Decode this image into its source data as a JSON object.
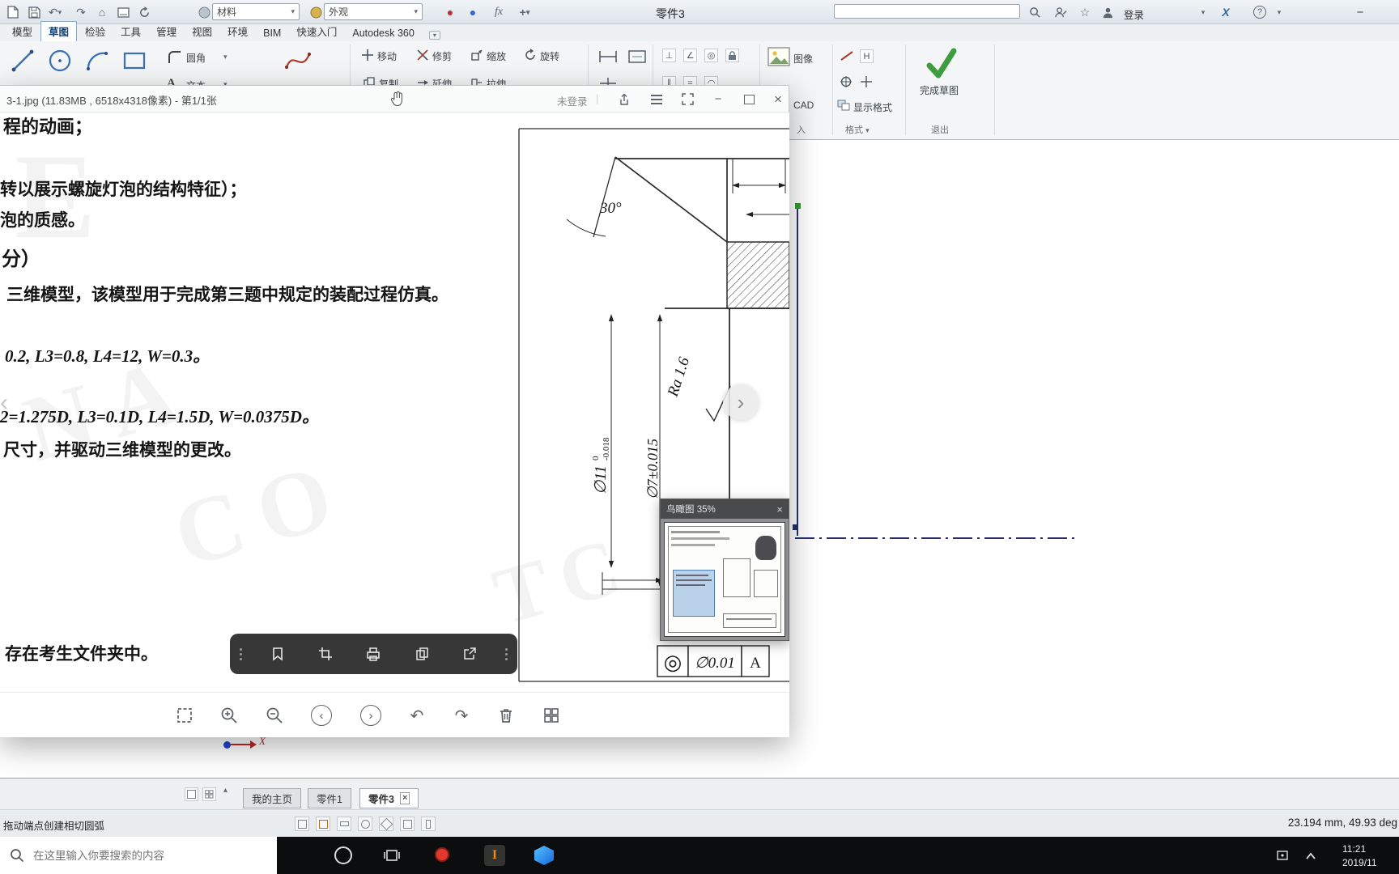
{
  "titlebar": {
    "title": "零件3",
    "material": "材料",
    "appearance": "外观",
    "signin": "登录"
  },
  "icons": {
    "caret": "▾",
    "undo": "↶",
    "redo": "↷",
    "home": "⌂",
    "red_dot": "●",
    "blue_dot": "●",
    "fx": "fx",
    "plus": "+",
    "star": "☆",
    "x_logo": "X",
    "help": "?",
    "minimize": "−",
    "close": "×",
    "prev": "‹",
    "next": "›",
    "pipe": "|",
    "up_caret": "▴",
    "perp": "⊥",
    "angle_c": "∠",
    "conc": "◎",
    "para": "∥",
    "equal": "=",
    "arc_c": "◠",
    "text_a": "A",
    "h_char": "H"
  },
  "ribbon": {
    "tabs": [
      "模型",
      "草图",
      "检验",
      "工具",
      "管理",
      "视图",
      "环境",
      "BIM",
      "快速入门",
      "Autodesk 360"
    ],
    "fillet": "圆角",
    "text_tool": "文本",
    "move": "移动",
    "trim": "修剪",
    "scale": "缩放",
    "rotate": "旋转",
    "copy": "复制",
    "extend": "延伸",
    "stretch": "拉伸",
    "image": "图像",
    "cad": "CAD",
    "display_format": "显示格式",
    "finish_sketch": "完成草图",
    "panel_insert": "入",
    "panel_format": "格式",
    "panel_exit": "退出"
  },
  "viewer": {
    "title": "3-1.jpg (11.83MB , 6518x4318像素) - 第1/1张",
    "login": "未登录",
    "doc_lines": [
      "程的动画；",
      "转以展示螺旋灯泡的结构特征）；",
      "泡的质感。",
      "分）",
      "三维模型，该模型用于完成第三题中规定的装配过程仿真。",
      "0.2, L3=0.8, L4=12, W=0.3。",
      "2=1.275D, L3=0.1D, L4=1.5D, W=0.0375D。",
      "尺寸，并驱动三维模型的更改。",
      "存在考生文件夹中。"
    ],
    "watermarks": [
      "E",
      "NA",
      "CO",
      "TC"
    ],
    "drawing": {
      "angle": "30°",
      "roughness": "Ra 1.6",
      "dia1": "∅11",
      "dia1_tol_upper": "0",
      "dia1_tol_lower": "-0.018",
      "dia2": "∅7±0.015",
      "fcf_symbol": "◎",
      "fcf_tolerance": "∅0.01",
      "fcf_datum": "A"
    },
    "birdview": {
      "title": "鸟瞰图 35%"
    }
  },
  "graphics": {
    "axis_x": "X"
  },
  "bottom": {
    "tabs": [
      "我的主页",
      "零件1",
      "零件3"
    ],
    "status_hint": "拖动端点创建相切圆弧",
    "coords": "23.194 mm, 49.93 deg"
  },
  "taskbar": {
    "search_placeholder": "在这里输入你要搜索的内容",
    "time": "11:21",
    "date": "2019/11"
  },
  "colors": {
    "finish_green": "#3d9c3d",
    "centerline_blue": "#26316e",
    "taskbar_black": "#0c0d0f"
  }
}
